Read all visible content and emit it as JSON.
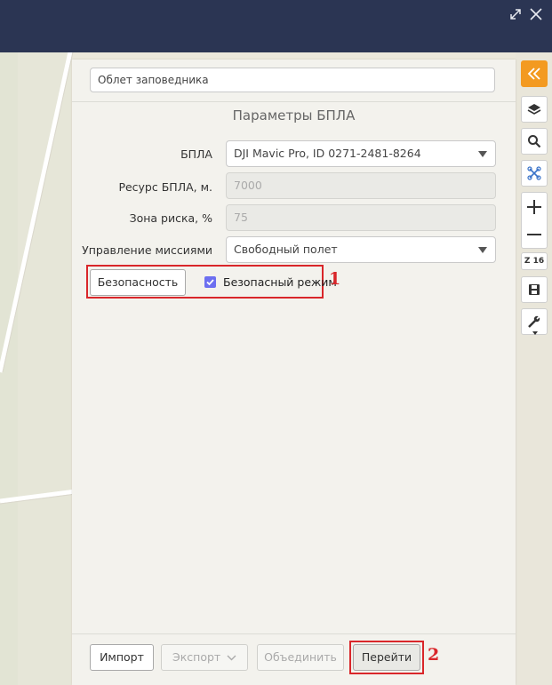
{
  "window": {
    "controls": [
      {
        "name": "expand-icon"
      },
      {
        "name": "close-icon"
      }
    ]
  },
  "mission": {
    "name_value": "Облет заповедника"
  },
  "uav_params": {
    "section_title": "Параметры БПЛА",
    "uav_label": "БПЛА",
    "uav_value": "DJI Mavic Pro, ID 0271-2481-8264",
    "resource_label": "Ресурс БПЛА, м.",
    "resource_value": "7000",
    "risk_label": "Зона риска, %",
    "risk_value": "75",
    "mission_control_label": "Управление миссиями",
    "mission_control_value": "Свободный полет"
  },
  "safety": {
    "button_label": "Безопасность",
    "safe_mode_label": "Безопасный режим",
    "safe_mode_checked": true,
    "marker": "1"
  },
  "footer": {
    "import_label": "Импорт",
    "export_label": "Экспорт",
    "merge_label": "Объединить",
    "go_label": "Перейти",
    "marker": "2"
  },
  "map_tools": {
    "zoom_level": "Z 16",
    "items": [
      "collapse-icon",
      "layers-icon",
      "search-icon",
      "drone-icon",
      "zoom-in-icon",
      "zoom-out-icon",
      "save-icon",
      "wrench-icon"
    ]
  },
  "colors": {
    "titlebar": "#2b3553",
    "accent_orange": "#f39a21",
    "highlight_red": "#d9262a",
    "checkbox": "#6c6ff0"
  }
}
